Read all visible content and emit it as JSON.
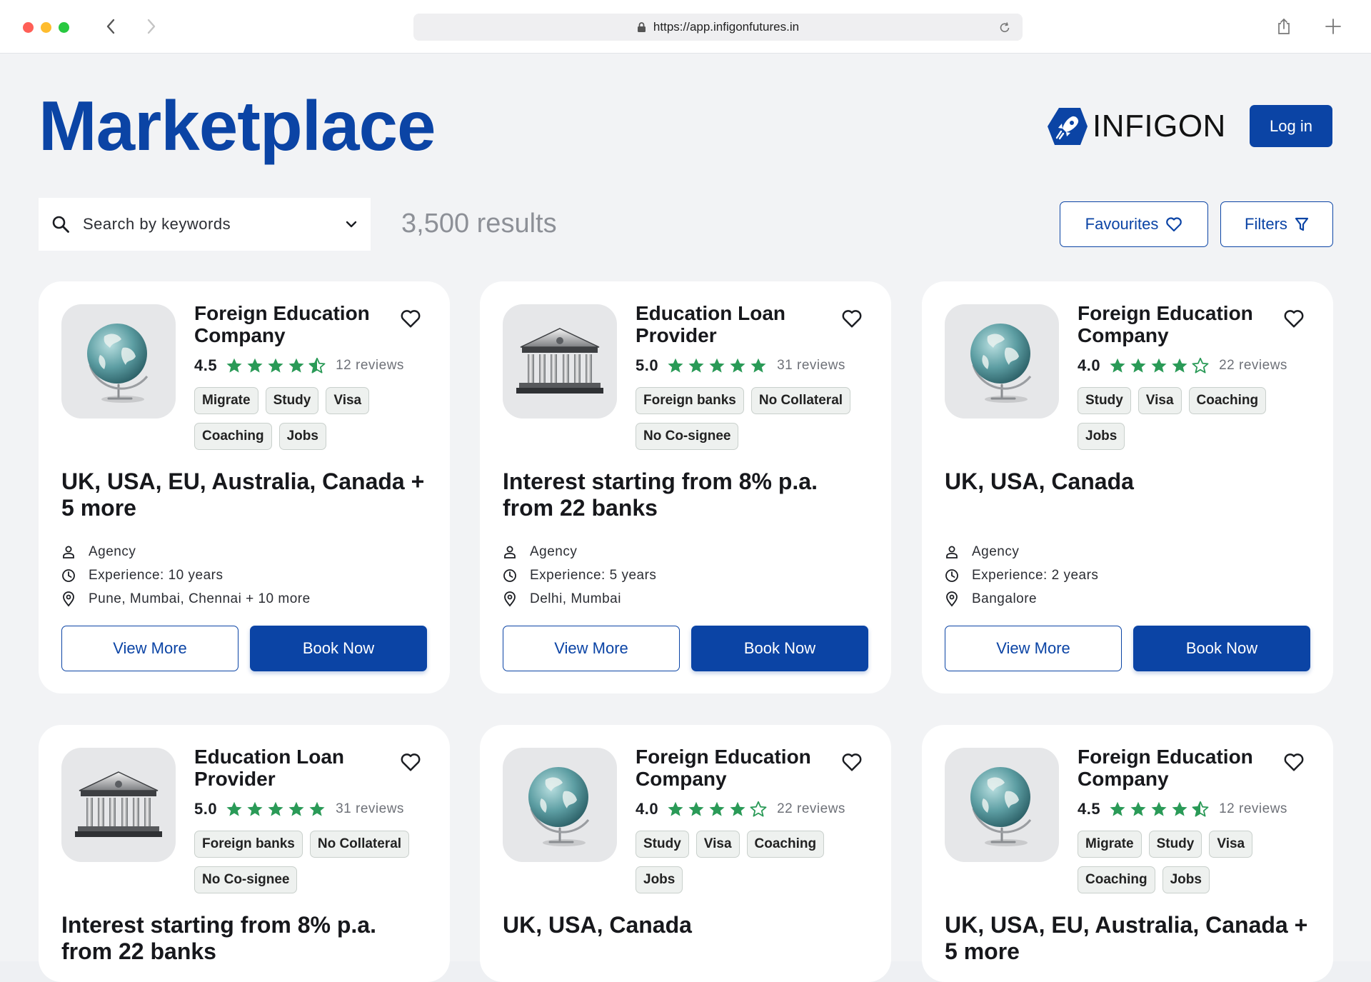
{
  "browser": {
    "url": "https://app.infigonfutures.in",
    "traffic_colors": [
      "#ff5f57",
      "#febc2e",
      "#28c840"
    ]
  },
  "header": {
    "title": "Marketplace",
    "brand_name": "INFIGON",
    "login_label": "Log in"
  },
  "toolbar": {
    "search_placeholder": "Search by keywords",
    "results_count": "3,500 results",
    "favourites_label": "Favourites",
    "filters_label": "Filters"
  },
  "colors": {
    "primary": "#0b44a5",
    "star": "#2a9a57",
    "page_bg": "#f2f3f5"
  },
  "cards": [
    {
      "type": "globe",
      "title": "Foreign Education Company",
      "rating": "4.5",
      "stars": 4.5,
      "reviews": "12 reviews",
      "tags": [
        "Migrate",
        "Study",
        "Visa",
        "Coaching",
        "Jobs"
      ],
      "headline": "UK, USA, EU, Australia, Canada + 5 more",
      "agency": "Agency",
      "experience": "Experience: 10 years",
      "locations": "Pune, Mumbai, Chennai + 10 more",
      "view_label": "View More",
      "book_label": "Book Now"
    },
    {
      "type": "bank",
      "title": "Education Loan Provider",
      "rating": "5.0",
      "stars": 5,
      "reviews": "31 reviews",
      "tags": [
        "Foreign banks",
        "No Collateral",
        "No Co-signee"
      ],
      "headline": "Interest starting from 8% p.a. from 22 banks",
      "agency": "Agency",
      "experience": "Experience: 5 years",
      "locations": "Delhi, Mumbai",
      "view_label": "View More",
      "book_label": "Book Now"
    },
    {
      "type": "globe",
      "title": "Foreign Education Company",
      "rating": "4.0",
      "stars": 4,
      "reviews": "22 reviews",
      "tags": [
        "Study",
        "Visa",
        "Coaching",
        "Jobs"
      ],
      "headline": "UK, USA, Canada",
      "agency": "Agency",
      "experience": "Experience: 2 years",
      "locations": "Bangalore",
      "view_label": "View More",
      "book_label": "Book Now"
    },
    {
      "type": "bank",
      "title": "Education Loan Provider",
      "rating": "5.0",
      "stars": 5,
      "reviews": "31 reviews",
      "tags": [
        "Foreign banks",
        "No Collateral",
        "No Co-signee"
      ],
      "headline": "Interest starting from 8% p.a. from 22 banks"
    },
    {
      "type": "globe",
      "title": "Foreign Education Company",
      "rating": "4.0",
      "stars": 4,
      "reviews": "22 reviews",
      "tags": [
        "Study",
        "Visa",
        "Coaching",
        "Jobs"
      ],
      "headline": "UK, USA, Canada"
    },
    {
      "type": "globe",
      "title": "Foreign Education Company",
      "rating": "4.5",
      "stars": 4.5,
      "reviews": "12 reviews",
      "tags": [
        "Migrate",
        "Study",
        "Visa",
        "Coaching",
        "Jobs"
      ],
      "headline": "UK, USA, EU, Australia, Canada + 5 more"
    }
  ]
}
